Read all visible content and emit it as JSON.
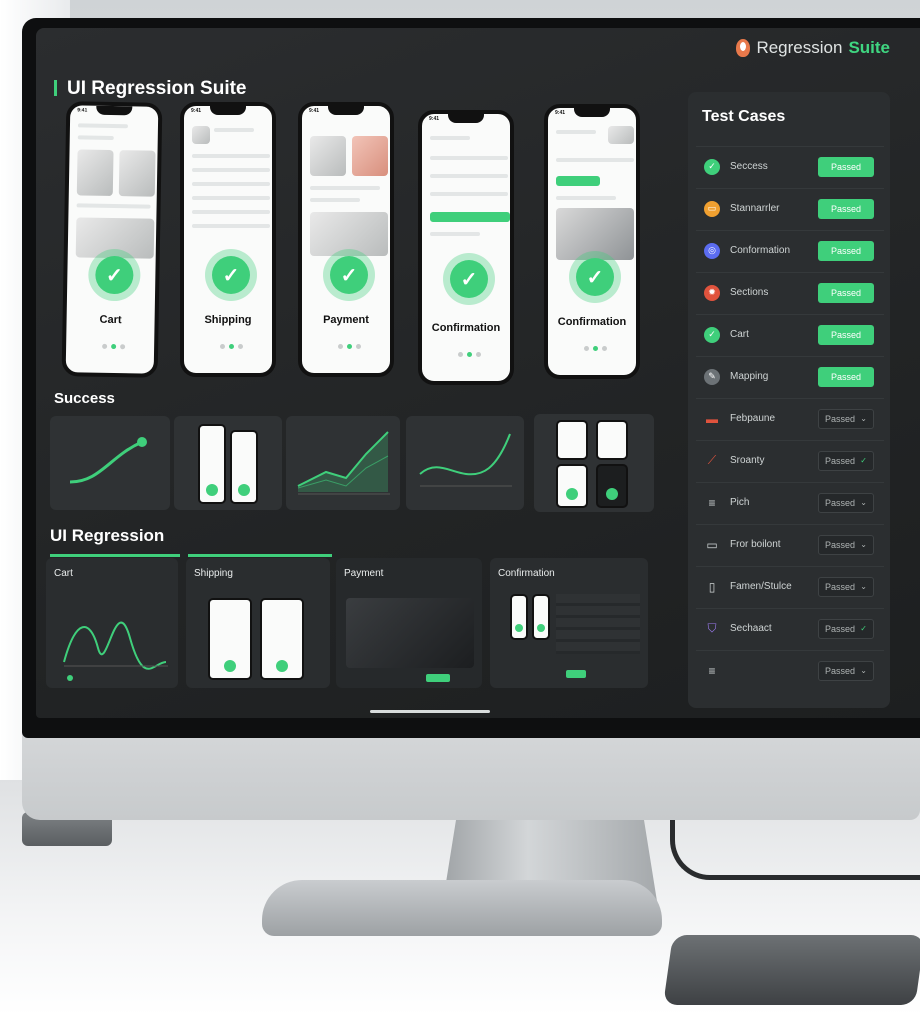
{
  "app": {
    "title": "UI Regression Suite",
    "brand_prefix": "Regression",
    "brand_accent": "Suite",
    "accent_color": "#3fcf7b"
  },
  "phones": [
    {
      "time": "9:41",
      "label": "Cart"
    },
    {
      "time": "9:41",
      "label": "Shipping"
    },
    {
      "time": "9:41",
      "label": "Payment"
    },
    {
      "time": "9:41",
      "label": "Confirmation"
    },
    {
      "time": "9:41",
      "label": "Confirmation"
    }
  ],
  "sections": {
    "success": "Success",
    "regression": "UI Regression"
  },
  "regression_cards": [
    "Cart",
    "Shipping",
    "Payment",
    "Confirmation"
  ],
  "test_cases": {
    "title": "Test Cases",
    "items": [
      {
        "name": "Seccess",
        "status": "Passed",
        "style": "solid",
        "icon": "check-icon",
        "color": "#3fcf7b"
      },
      {
        "name": "Stannarrler",
        "status": "Passed",
        "style": "solid",
        "icon": "window-icon",
        "color": "#f0a030"
      },
      {
        "name": "Conformation",
        "status": "Passed",
        "style": "solid",
        "icon": "target-icon",
        "color": "#5b6cf0"
      },
      {
        "name": "Sections",
        "status": "Passed",
        "style": "solid",
        "icon": "bug-icon",
        "color": "#e0533d"
      },
      {
        "name": "Cart",
        "status": "Passed",
        "style": "solid",
        "icon": "check-icon",
        "color": "#3fcf7b"
      },
      {
        "name": "Mapping",
        "status": "Passed",
        "style": "solid",
        "icon": "pencil-icon",
        "color": "#6c7276"
      },
      {
        "name": "Febpaune",
        "status": "Passed",
        "style": "outline",
        "icon": "card-icon",
        "color": "#e0533d"
      },
      {
        "name": "Sroanty",
        "status": "Passed",
        "style": "outline-green",
        "icon": "chart-icon",
        "color": "#e0533d"
      },
      {
        "name": "Pich",
        "status": "Passed",
        "style": "outline",
        "icon": "menu-icon",
        "color": "#cfd4d4"
      },
      {
        "name": "Fror boilont",
        "status": "Passed",
        "style": "outline",
        "icon": "screen-icon",
        "color": "#cfd4d4"
      },
      {
        "name": "Famen/Stulce",
        "status": "Passed",
        "style": "outline",
        "icon": "phone-icon",
        "color": "#cfd4d4"
      },
      {
        "name": "Sechaact",
        "status": "Passed",
        "style": "outline-green",
        "icon": "shield-icon",
        "color": "#9c7bf0"
      },
      {
        "name": "",
        "status": "Passed",
        "style": "outline",
        "icon": "menu-icon",
        "color": "#cfd4d4"
      }
    ]
  }
}
